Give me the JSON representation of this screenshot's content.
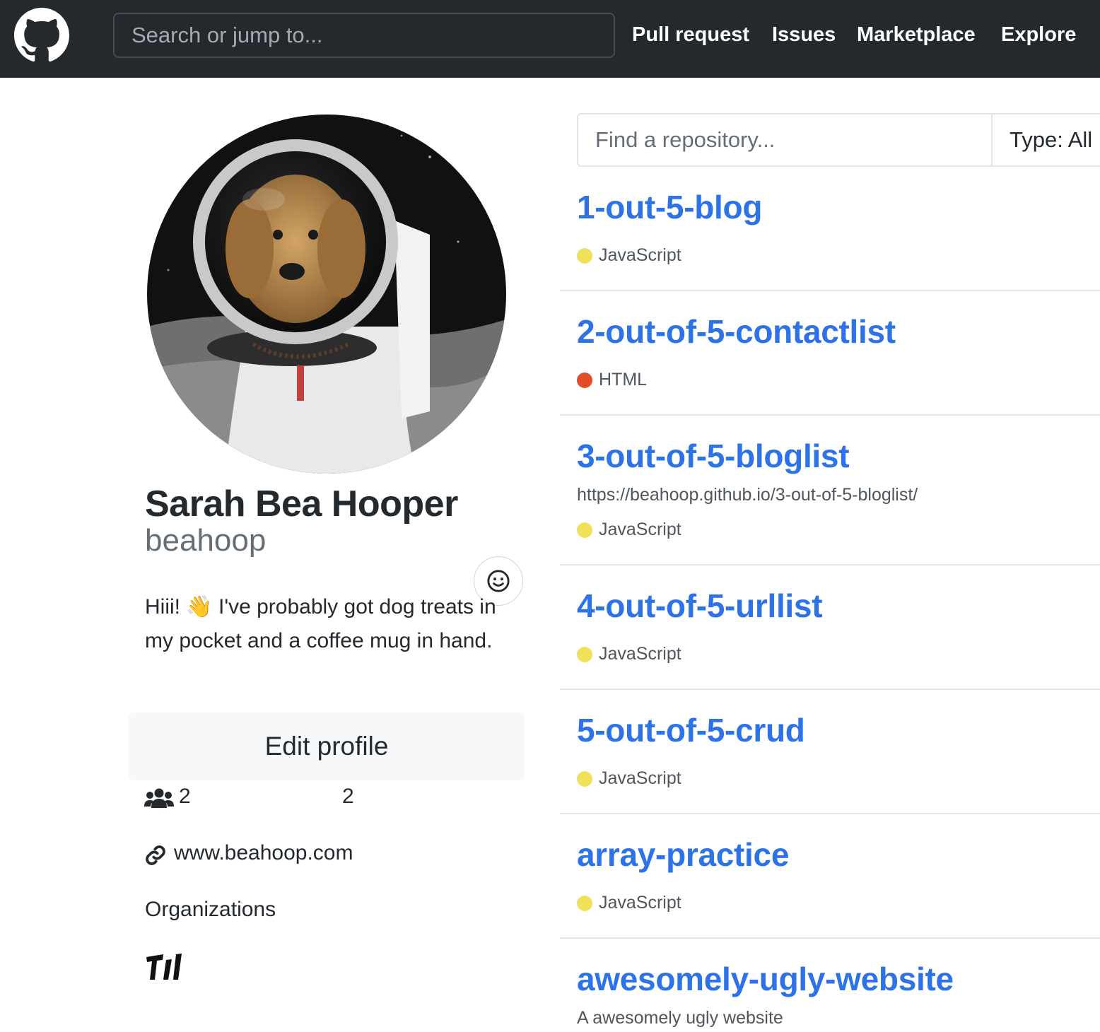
{
  "header": {
    "search_placeholder": "Search or jump to...",
    "nav": [
      "Pull request",
      "Issues",
      "Marketplace",
      "Explore"
    ]
  },
  "profile": {
    "full_name": "Sarah Bea Hooper",
    "login": "beahoop",
    "bio": "Hiii! 👋 I've probably got dog treats in my pocket and a coffee mug in hand.",
    "edit_label": "Edit profile",
    "followers": "2",
    "following": "2",
    "website": "www.beahoop.com",
    "orgs_heading": "Organizations",
    "org_badge_text": "TI"
  },
  "repos_panel": {
    "find_placeholder": "Find a repository...",
    "type_label": "Type: All"
  },
  "languages": {
    "JavaScript": "#f1e05a",
    "HTML": "#e34c26"
  },
  "repos": [
    {
      "name": "1-out-5-blog",
      "description": "",
      "language": "JavaScript"
    },
    {
      "name": "2-out-of-5-contactlist",
      "description": "",
      "language": "HTML"
    },
    {
      "name": "3-out-of-5-bloglist",
      "description": "https://beahoop.github.io/3-out-of-5-bloglist/",
      "language": "JavaScript"
    },
    {
      "name": "4-out-of-5-urllist",
      "description": "",
      "language": "JavaScript"
    },
    {
      "name": "5-out-of-5-crud",
      "description": "",
      "language": "JavaScript"
    },
    {
      "name": "array-practice",
      "description": "",
      "language": "JavaScript"
    },
    {
      "name": "awesomely-ugly-website",
      "description": "A awesomely ugly website",
      "language": ""
    }
  ]
}
